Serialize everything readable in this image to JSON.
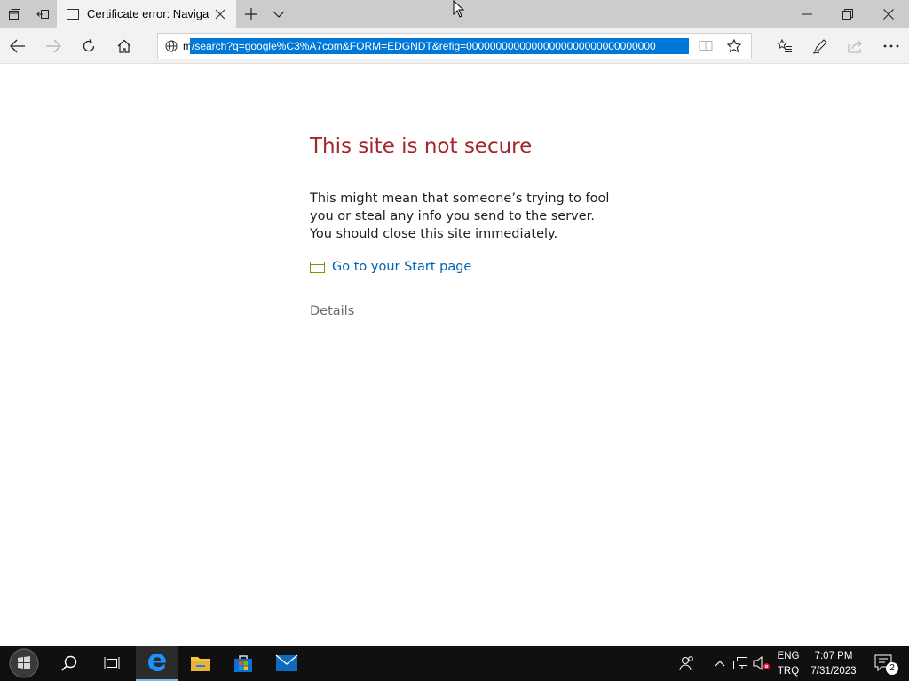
{
  "browser": {
    "tab": {
      "title": "Certificate error: Naviga"
    },
    "address": {
      "prefix": "m",
      "selected_url": "/search?q=google%C3%A7com&FORM=EDGNDT&refig=00000000000000000000000000000000"
    }
  },
  "page": {
    "title": "This site is not secure",
    "body": "This might mean that someone’s trying to fool you or steal any info you send to the server. You should close this site immediately.",
    "start_link": "Go to your Start page",
    "details": "Details"
  },
  "taskbar": {
    "language": {
      "line1": "ENG",
      "line2": "TRQ"
    },
    "clock": {
      "time": "7:07 PM",
      "date": "7/31/2023"
    },
    "notification_count": "2"
  },
  "colors": {
    "title_red": "#a4262c",
    "link_blue": "#0063b1",
    "selection_blue": "#0078d7"
  }
}
